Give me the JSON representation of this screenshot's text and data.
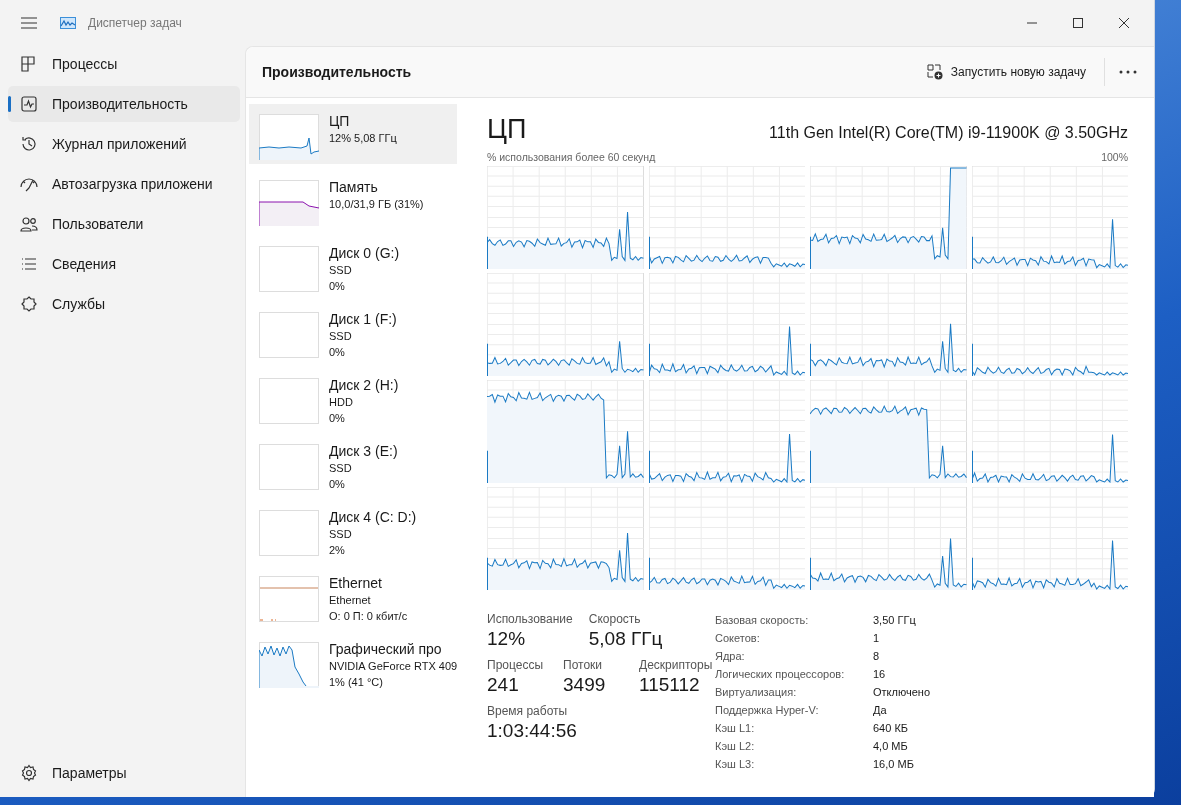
{
  "window": {
    "title": "Диспетчер задач"
  },
  "nav": {
    "items": [
      {
        "label": "Процессы",
        "selected": false
      },
      {
        "label": "Производительность",
        "selected": true
      },
      {
        "label": "Журнал приложений",
        "selected": false
      },
      {
        "label": "Автозагрузка приложени",
        "selected": false
      },
      {
        "label": "Пользователи",
        "selected": false
      },
      {
        "label": "Сведения",
        "selected": false
      },
      {
        "label": "Службы",
        "selected": false
      }
    ],
    "settings": "Параметры"
  },
  "header": {
    "title": "Производительность",
    "action": "Запустить новую задачу"
  },
  "resources": [
    {
      "kind": "cpu",
      "name": "ЦП",
      "lines": [
        "12%  5,08 ГГц"
      ],
      "selected": true
    },
    {
      "kind": "memory",
      "name": "Память",
      "lines": [
        "10,0/31,9 ГБ (31%)"
      ],
      "selected": false
    },
    {
      "kind": "disk",
      "name": "Диск 0 (G:)",
      "lines": [
        "SSD",
        "0%"
      ],
      "selected": false
    },
    {
      "kind": "disk",
      "name": "Диск 1 (F:)",
      "lines": [
        "SSD",
        "0%"
      ],
      "selected": false
    },
    {
      "kind": "disk",
      "name": "Диск 2 (H:)",
      "lines": [
        "HDD",
        "0%"
      ],
      "selected": false
    },
    {
      "kind": "disk",
      "name": "Диск 3 (E:)",
      "lines": [
        "SSD",
        "0%"
      ],
      "selected": false
    },
    {
      "kind": "disk",
      "name": "Диск 4 (C: D:)",
      "lines": [
        "SSD",
        "2%"
      ],
      "selected": false
    },
    {
      "kind": "ethernet",
      "name": "Ethernet",
      "lines": [
        "Ethernet",
        "О: 0 П: 0 кбит/с"
      ],
      "selected": false
    },
    {
      "kind": "gpu",
      "name": "Графический про",
      "lines": [
        "NVIDIA GeForce RTX 409",
        "1%  (41 °C)"
      ],
      "selected": false
    }
  ],
  "detail": {
    "title": "ЦП",
    "model": "11th Gen Intel(R) Core(TM) i9-11900K @ 3.50GHz",
    "graph_caption": "% использования более 60 секунд",
    "graph_max": "100%",
    "stat_rows": [
      [
        {
          "label": "Использование",
          "value": "12%"
        },
        {
          "label": "Скорость",
          "value": "5,08 ГГц"
        }
      ],
      [
        {
          "label": "Процессы",
          "value": "241"
        },
        {
          "label": "Потоки",
          "value": "3499"
        },
        {
          "label": "Дескрипторы",
          "value": "115112"
        }
      ],
      [
        {
          "label": "Время работы",
          "value": "1:03:44:56"
        }
      ]
    ],
    "specs": [
      {
        "label": "Базовая скорость:",
        "value": "3,50 ГГц"
      },
      {
        "label": "Сокетов:",
        "value": "1"
      },
      {
        "label": "Ядра:",
        "value": "8"
      },
      {
        "label": "Логических процессоров:",
        "value": "16"
      },
      {
        "label": "Виртуализация:",
        "value": "Отключено"
      },
      {
        "label": "Поддержка Hyper-V:",
        "value": "Да"
      },
      {
        "label": "Кэш L1:",
        "value": "640 КБ"
      },
      {
        "label": "Кэш L2:",
        "value": "4,0 МБ"
      },
      {
        "label": "Кэш L3:",
        "value": "16,0 МБ"
      }
    ]
  }
}
